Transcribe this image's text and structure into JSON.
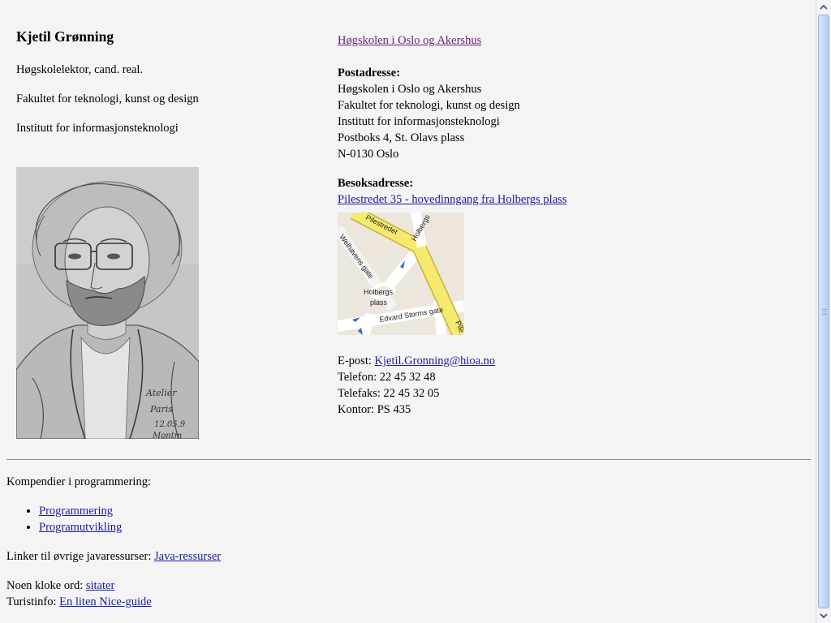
{
  "person": {
    "name": "Kjetil Grønning",
    "title": "Høgskolelektor, cand. real.",
    "faculty": "Fakultet for teknologi, kunst og design",
    "department": "Institutt for informasjonsteknologi"
  },
  "portrait": {
    "signature_lines": [
      "Atelier",
      "Paris",
      "12.05.9",
      "Montm"
    ]
  },
  "contact": {
    "school_link": "Høgskolen i Oslo og Akershus",
    "postal_heading": "Postadresse:",
    "postal_lines": [
      "Høgskolen i Oslo og Akershus",
      "Fakultet for teknologi, kunst og design",
      "Institutt for informasjonsteknologi",
      "Postboks 4, St. Olavs plass",
      "N-0130 Oslo"
    ],
    "visit_heading": "Besoksadresse:",
    "visit_link": "Pilestredet 35 - hovedinngang fra Holbergs plass",
    "map_labels": {
      "pilestredet": "Pilestredet",
      "holbergs": "Holbergs",
      "welhavens": "Welhavens gate",
      "plass_line1": "Holbergs",
      "plass_line2": "plass",
      "edvard": "Edvard Storms gate",
      "pile": "Pile"
    },
    "email_label": "E-post:",
    "email": "Kjetil.Gronning@hioa.no",
    "phone": "Telefon: 22 45 32 48",
    "fax": "Telefaks: 22 45 32 05",
    "office": "Kontor: PS 435"
  },
  "compendia": {
    "heading": "Kompendier i programmering:",
    "items": [
      "Programmering",
      "Programutvikling"
    ]
  },
  "java_text": "Linker til øvrige javaressurser:",
  "java_link": "Java-ressurser",
  "quotes_text": "Noen kloke ord:",
  "quotes_link": "sitater",
  "tourist_text": "Turistinfo:",
  "tourist_link": "En liten Nice-guide",
  "colors": {
    "background": "#f4f4f4",
    "link": "#1a1a9e",
    "visited_link": "#6a1b7a",
    "map_main_road": "#f5ea6f"
  }
}
